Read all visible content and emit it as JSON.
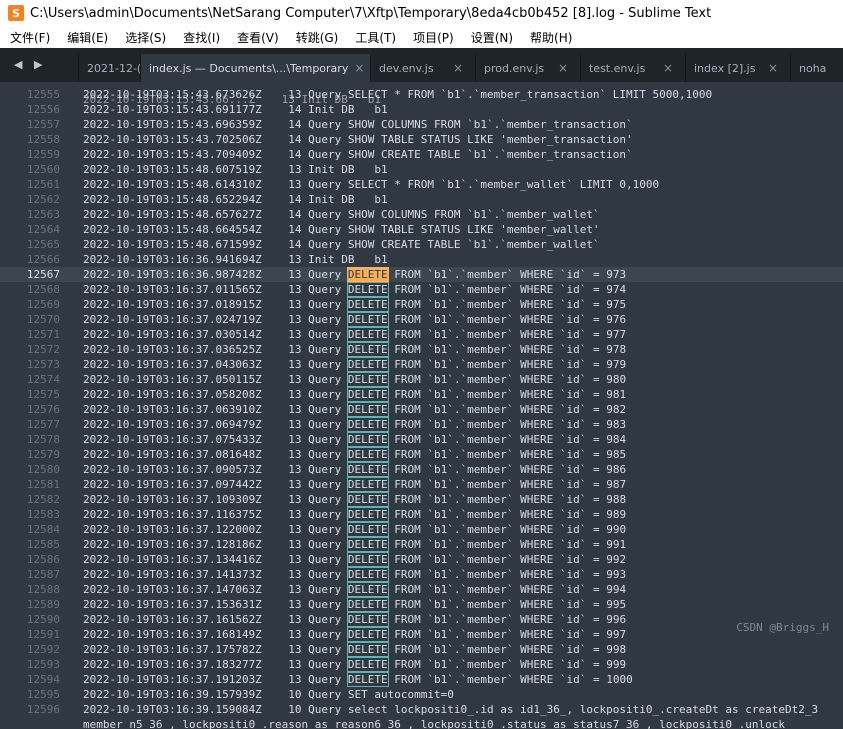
{
  "window": {
    "title": "C:\\Users\\admin\\Documents\\NetSarang Computer\\7\\Xftp\\Temporary\\8eda4cb0b452 [8].log - Sublime Text",
    "app_icon": "S"
  },
  "menu": [
    {
      "label": "文件(F)"
    },
    {
      "label": "编辑(E)"
    },
    {
      "label": "选择(S)"
    },
    {
      "label": "查找(I)"
    },
    {
      "label": "查看(V)"
    },
    {
      "label": "转跳(G)"
    },
    {
      "label": "工具(T)"
    },
    {
      "label": "项目(P)"
    },
    {
      "label": "设置(N)"
    },
    {
      "label": "帮助(H)"
    }
  ],
  "tabs": [
    {
      "label": "2021-12-(",
      "close": ""
    },
    {
      "label": "index.js — Documents\\...\\Temporary",
      "close": "×"
    },
    {
      "label": "dev.env.js",
      "close": "×"
    },
    {
      "label": "prod.env.js",
      "close": "×"
    },
    {
      "label": "test.env.js",
      "close": "×"
    },
    {
      "label": "index [2].js",
      "close": "×"
    },
    {
      "label": "noha",
      "close": ""
    }
  ],
  "nav_arrows": "◀ ▶",
  "colors": {
    "editor_bg": "#303841",
    "text": "#d8dee9",
    "gutter": "#6b737c",
    "selection": "#f9ae58",
    "match_border": "#5fb3b3"
  },
  "editor": {
    "partial_top": "2022-10-19T03:15:43.66...Z    13 Init DB   b1",
    "lines": [
      {
        "num": "12555",
        "pre": "2022-10-19T03:15:43.673626Z    13 Query SELECT * FROM `b1`.`member_transaction` LIMIT 5000,1000"
      },
      {
        "num": "12556",
        "pre": "2022-10-19T03:15:43.691177Z    14 Init DB   b1"
      },
      {
        "num": "12557",
        "pre": "2022-10-19T03:15:43.696359Z    14 Query SHOW COLUMNS FROM `b1`.`member_transaction`"
      },
      {
        "num": "12558",
        "pre": "2022-10-19T03:15:43.702506Z    14 Query SHOW TABLE STATUS LIKE 'member_transaction'"
      },
      {
        "num": "12559",
        "pre": "2022-10-19T03:15:43.709409Z    14 Query SHOW CREATE TABLE `b1`.`member_transaction`"
      },
      {
        "num": "12560",
        "pre": "2022-10-19T03:15:48.607519Z    13 Init DB   b1"
      },
      {
        "num": "12561",
        "pre": "2022-10-19T03:15:48.614310Z    13 Query SELECT * FROM `b1`.`member_wallet` LIMIT 0,1000"
      },
      {
        "num": "12562",
        "pre": "2022-10-19T03:15:48.652294Z    14 Init DB   b1"
      },
      {
        "num": "12563",
        "pre": "2022-10-19T03:15:48.657627Z    14 Query SHOW COLUMNS FROM `b1`.`member_wallet`"
      },
      {
        "num": "12564",
        "pre": "2022-10-19T03:15:48.664554Z    14 Query SHOW TABLE STATUS LIKE 'member_wallet'"
      },
      {
        "num": "12565",
        "pre": "2022-10-19T03:15:48.671599Z    14 Query SHOW CREATE TABLE `b1`.`member_wallet`"
      },
      {
        "num": "12566",
        "pre": "2022-10-19T03:16:36.941694Z    13 Init DB   b1"
      },
      {
        "num": "12567",
        "pre": "2022-10-19T03:16:36.987428Z    13 Query ",
        "hl": "DELETE",
        "post": " FROM `b1`.`member` WHERE `id` = 973",
        "current": true
      },
      {
        "num": "12568",
        "pre": "2022-10-19T03:16:37.011565Z    13 Query ",
        "hl": "DELETE",
        "post": " FROM `b1`.`member` WHERE `id` = 974"
      },
      {
        "num": "12569",
        "pre": "2022-10-19T03:16:37.018915Z    13 Query ",
        "hl": "DELETE",
        "post": " FROM `b1`.`member` WHERE `id` = 975"
      },
      {
        "num": "12570",
        "pre": "2022-10-19T03:16:37.024719Z    13 Query ",
        "hl": "DELETE",
        "post": " FROM `b1`.`member` WHERE `id` = 976"
      },
      {
        "num": "12571",
        "pre": "2022-10-19T03:16:37.030514Z    13 Query ",
        "hl": "DELETE",
        "post": " FROM `b1`.`member` WHERE `id` = 977"
      },
      {
        "num": "12572",
        "pre": "2022-10-19T03:16:37.036525Z    13 Query ",
        "hl": "DELETE",
        "post": " FROM `b1`.`member` WHERE `id` = 978"
      },
      {
        "num": "12573",
        "pre": "2022-10-19T03:16:37.043063Z    13 Query ",
        "hl": "DELETE",
        "post": " FROM `b1`.`member` WHERE `id` = 979"
      },
      {
        "num": "12574",
        "pre": "2022-10-19T03:16:37.050115Z    13 Query ",
        "hl": "DELETE",
        "post": " FROM `b1`.`member` WHERE `id` = 980"
      },
      {
        "num": "12575",
        "pre": "2022-10-19T03:16:37.058208Z    13 Query ",
        "hl": "DELETE",
        "post": " FROM `b1`.`member` WHERE `id` = 981"
      },
      {
        "num": "12576",
        "pre": "2022-10-19T03:16:37.063910Z    13 Query ",
        "hl": "DELETE",
        "post": " FROM `b1`.`member` WHERE `id` = 982"
      },
      {
        "num": "12577",
        "pre": "2022-10-19T03:16:37.069479Z    13 Query ",
        "hl": "DELETE",
        "post": " FROM `b1`.`member` WHERE `id` = 983"
      },
      {
        "num": "12578",
        "pre": "2022-10-19T03:16:37.075433Z    13 Query ",
        "hl": "DELETE",
        "post": " FROM `b1`.`member` WHERE `id` = 984"
      },
      {
        "num": "12579",
        "pre": "2022-10-19T03:16:37.081648Z    13 Query ",
        "hl": "DELETE",
        "post": " FROM `b1`.`member` WHERE `id` = 985"
      },
      {
        "num": "12580",
        "pre": "2022-10-19T03:16:37.090573Z    13 Query ",
        "hl": "DELETE",
        "post": " FROM `b1`.`member` WHERE `id` = 986"
      },
      {
        "num": "12581",
        "pre": "2022-10-19T03:16:37.097442Z    13 Query ",
        "hl": "DELETE",
        "post": " FROM `b1`.`member` WHERE `id` = 987"
      },
      {
        "num": "12582",
        "pre": "2022-10-19T03:16:37.109309Z    13 Query ",
        "hl": "DELETE",
        "post": " FROM `b1`.`member` WHERE `id` = 988"
      },
      {
        "num": "12583",
        "pre": "2022-10-19T03:16:37.116375Z    13 Query ",
        "hl": "DELETE",
        "post": " FROM `b1`.`member` WHERE `id` = 989"
      },
      {
        "num": "12584",
        "pre": "2022-10-19T03:16:37.122000Z    13 Query ",
        "hl": "DELETE",
        "post": " FROM `b1`.`member` WHERE `id` = 990"
      },
      {
        "num": "12585",
        "pre": "2022-10-19T03:16:37.128186Z    13 Query ",
        "hl": "DELETE",
        "post": " FROM `b1`.`member` WHERE `id` = 991"
      },
      {
        "num": "12586",
        "pre": "2022-10-19T03:16:37.134416Z    13 Query ",
        "hl": "DELETE",
        "post": " FROM `b1`.`member` WHERE `id` = 992"
      },
      {
        "num": "12587",
        "pre": "2022-10-19T03:16:37.141373Z    13 Query ",
        "hl": "DELETE",
        "post": " FROM `b1`.`member` WHERE `id` = 993"
      },
      {
        "num": "12588",
        "pre": "2022-10-19T03:16:37.147063Z    13 Query ",
        "hl": "DELETE",
        "post": " FROM `b1`.`member` WHERE `id` = 994"
      },
      {
        "num": "12589",
        "pre": "2022-10-19T03:16:37.153631Z    13 Query ",
        "hl": "DELETE",
        "post": " FROM `b1`.`member` WHERE `id` = 995"
      },
      {
        "num": "12590",
        "pre": "2022-10-19T03:16:37.161562Z    13 Query ",
        "hl": "DELETE",
        "post": " FROM `b1`.`member` WHERE `id` = 996"
      },
      {
        "num": "12591",
        "pre": "2022-10-19T03:16:37.168149Z    13 Query ",
        "hl": "DELETE",
        "post": " FROM `b1`.`member` WHERE `id` = 997"
      },
      {
        "num": "12592",
        "pre": "2022-10-19T03:16:37.175782Z    13 Query ",
        "hl": "DELETE",
        "post": " FROM `b1`.`member` WHERE `id` = 998"
      },
      {
        "num": "12593",
        "pre": "2022-10-19T03:16:37.183277Z    13 Query ",
        "hl": "DELETE",
        "post": " FROM `b1`.`member` WHERE `id` = 999"
      },
      {
        "num": "12594",
        "pre": "2022-10-19T03:16:37.191203Z    13 Query ",
        "hl": "DELETE",
        "post": " FROM `b1`.`member` WHERE `id` = 1000"
      },
      {
        "num": "12595",
        "pre": "2022-10-19T03:16:39.157939Z    10 Query SET autocommit=0"
      },
      {
        "num": "12596",
        "pre": "2022-10-19T03:16:39.159084Z    10 Query select lockpositi0_.id as id1_36_, lockpositi0_.createDt as createDt2_3"
      },
      {
        "num": "",
        "pre": "member n5 36 , lockpositi0 .reason as reason6 36 , lockpositi0 .status as status7 36 , lockpositi0 .unlock"
      }
    ],
    "watermark": "CSDN @Briggs_H"
  }
}
